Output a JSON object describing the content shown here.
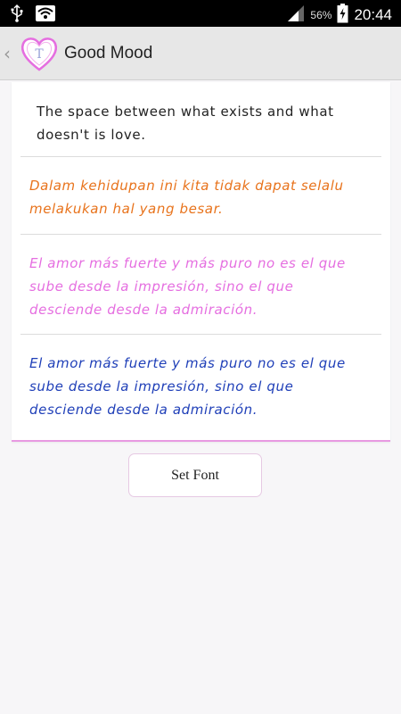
{
  "status_bar": {
    "battery_percent": "56%",
    "time": "20:44"
  },
  "action_bar": {
    "title": "Good Mood",
    "icon_letters": "T"
  },
  "samples": [
    {
      "text": "The space between what exists and what doesn't is love.",
      "color": "#222222"
    },
    {
      "text": "Dalam kehidupan ini kita tidak dapat selalu melakukan hal yang besar.",
      "color": "#e8731c"
    },
    {
      "text": "El amor más fuerte y más puro no es el que sube desde la impresión, sino el que desciende desde la admiración.",
      "color": "#e56ee0"
    },
    {
      "text": "El amor más fuerte y más puro no es el que sube desde la impresión, sino el que desciende desde la admiración.",
      "color": "#1f3fb8"
    }
  ],
  "button": {
    "label": "Set Font"
  },
  "colors": {
    "accent": "#e89ae2",
    "action_bar": "#e7e7e7"
  }
}
